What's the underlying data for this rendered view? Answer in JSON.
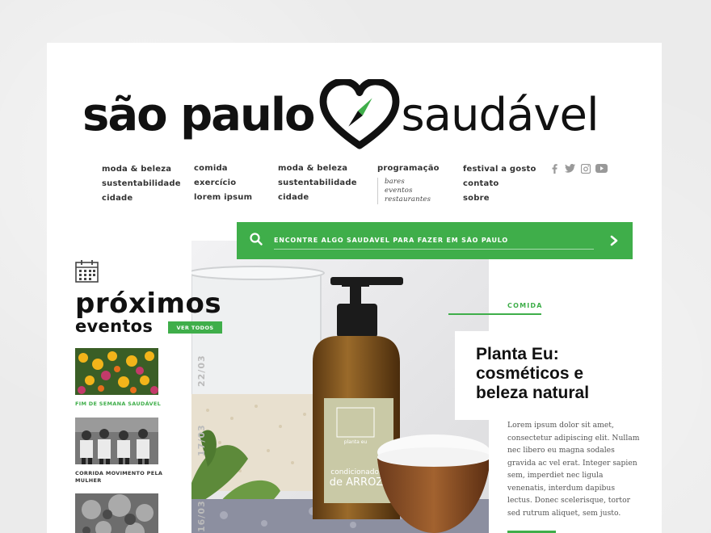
{
  "logo": {
    "left_text": "são paulo",
    "right_text": "saudável"
  },
  "nav": {
    "col1": [
      "moda & beleza",
      "sustentabilidade",
      "cidade"
    ],
    "col2": [
      "comida",
      "exercício",
      "lorem ipsum"
    ],
    "col3": [
      "moda & beleza",
      "sustentabilidade",
      "cidade"
    ],
    "col4": {
      "title": "programação",
      "sub": [
        "bares",
        "eventos",
        "restaurantes"
      ]
    },
    "col5": [
      "festival a gosto",
      "contato",
      "sobre"
    ],
    "social_icons": [
      "facebook-icon",
      "twitter-icon",
      "instagram-icon",
      "youtube-icon"
    ]
  },
  "search": {
    "placeholder": "ENCONTRE ALGO SAUDÁVEL PARA FAZER EM SÃO PAULO"
  },
  "events": {
    "title_line1": "próximos",
    "title_line2": "eventos",
    "see_all": "VER TODOS",
    "items": [
      {
        "date": "22/03",
        "label": "FIM DE SEMANA SAUDÁVEL",
        "highlight": true
      },
      {
        "date": "17/03",
        "label": "CORRIDA MOVIMENTO PELA MULHER",
        "highlight": false
      },
      {
        "date": "16/03",
        "label": "",
        "highlight": false
      }
    ]
  },
  "hero": {
    "bottle_brand": "planta eu",
    "bottle_line1": "condicionador",
    "bottle_line2": "de ARROZ"
  },
  "article": {
    "category": "COMIDA",
    "title_line1": "Planta Eu:",
    "title_line2": "cosméticos e",
    "title_line3": "beleza natural",
    "body": "Lorem ipsum dolor sit amet, consectetur adipiscing elit. Nullam nec libero eu magna sodales gravida ac vel erat. Integer sapien sem, imperdiet nec ligula venenatis, interdum dapibus lectus. Donec scelerisque, tortor sed rutrum aliquet, sem justo."
  },
  "colors": {
    "accent": "#3fae4a",
    "text": "#111111",
    "background": "#ebebeb"
  }
}
